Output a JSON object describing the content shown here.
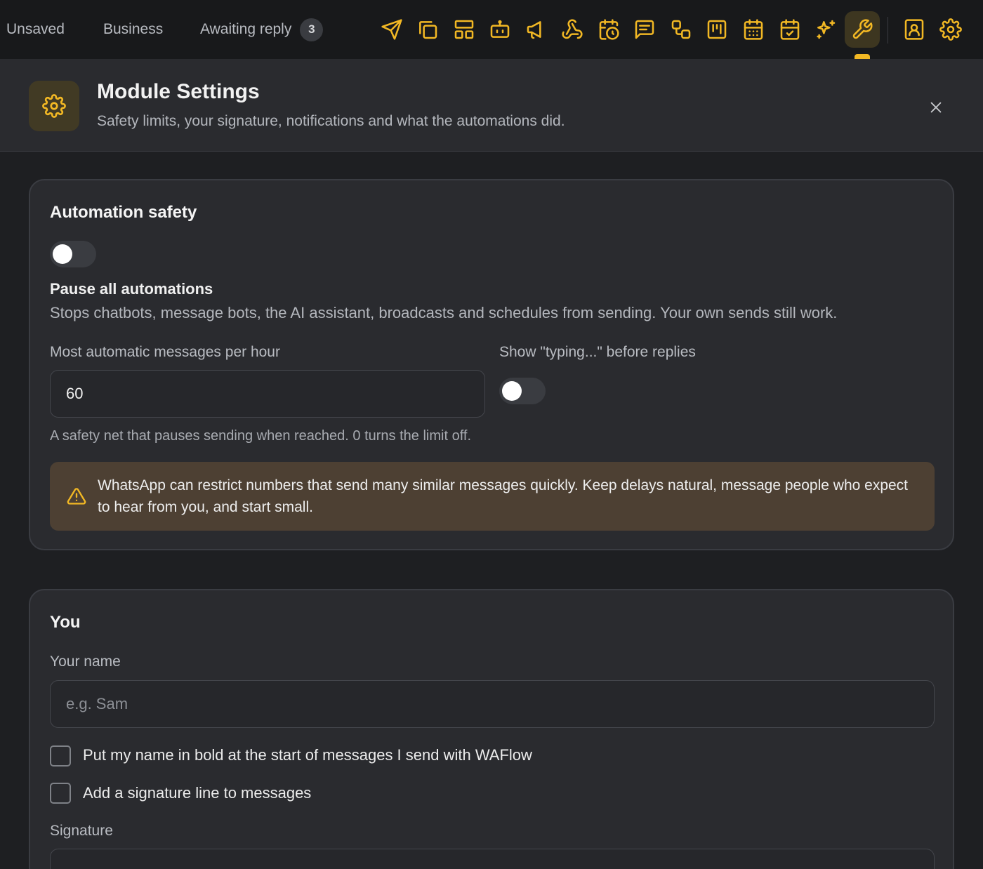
{
  "topbar": {
    "tabs": [
      {
        "label": "Unsaved"
      },
      {
        "label": "Business"
      },
      {
        "label": "Awaiting reply",
        "count": "3"
      }
    ],
    "tools": [
      "send-icon",
      "copy-icon",
      "layout-icon",
      "bot-icon",
      "megaphone-icon",
      "webhook-icon",
      "calendar-clock-icon",
      "message-square-icon",
      "flow-icon",
      "kanban-icon",
      "calendar-icon",
      "calendar-check-icon",
      "sparkles-icon",
      "wrench-icon",
      "contact-icon",
      "gear-icon"
    ],
    "active_tool": "wrench-icon",
    "accent_color": "#f2b824"
  },
  "header": {
    "title": "Module Settings",
    "subtitle": "Safety limits, your signature, notifications and what the automations did."
  },
  "safety": {
    "title": "Automation safety",
    "pause": {
      "enabled": false,
      "label": "Pause all automations",
      "description": "Stops chatbots, message bots, the AI assistant, broadcasts and schedules from sending. Your own sends still work."
    },
    "rate_limit": {
      "label": "Most automatic messages per hour",
      "value": "60",
      "hint": "A safety net that pauses sending when reached. 0 turns the limit off."
    },
    "typing": {
      "label": "Show \"typing...\" before replies",
      "enabled": false
    },
    "warning": "WhatsApp can restrict numbers that send many similar messages quickly. Keep delays natural, message people who expect to hear from you, and start small."
  },
  "you": {
    "title": "You",
    "name": {
      "label": "Your name",
      "placeholder": "e.g. Sam",
      "value": ""
    },
    "bold_name": {
      "label": "Put my name in bold at the start of messages I send with WAFlow",
      "checked": false
    },
    "signature_line": {
      "label": "Add a signature line to messages",
      "checked": false
    },
    "signature": {
      "label": "Signature"
    }
  }
}
